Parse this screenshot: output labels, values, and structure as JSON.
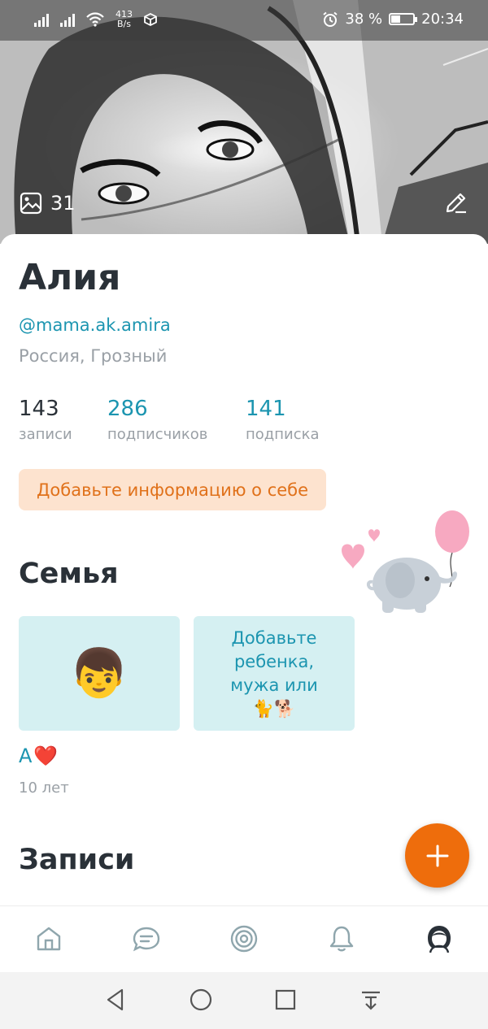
{
  "status_bar": {
    "net_speed_value": "413",
    "net_speed_unit": "B/s",
    "battery_percent": "38 %",
    "battery_level": 0.38,
    "time": "20:34"
  },
  "cover": {
    "photo_count": "31",
    "icons": {
      "photos": "image-icon",
      "edit": "pencil-icon"
    }
  },
  "profile": {
    "name": "Алия",
    "handle": "@mama.ak.amira",
    "location": "Россия, Грозный",
    "stats": [
      {
        "value": "143",
        "label": "записи"
      },
      {
        "value": "286",
        "label": "подписчиков"
      },
      {
        "value": "141",
        "label": "подписка"
      }
    ],
    "about_button": "Добавьте информацию о себе"
  },
  "family": {
    "title": "Семья",
    "child": {
      "emoji": "👦",
      "name": "А",
      "name_emoji": "❤️",
      "age": "10 лет"
    },
    "add_tile_lines": [
      "Добавьте",
      "ребенка,",
      "мужа или",
      "🐈🐕"
    ]
  },
  "posts": {
    "title": "Записи"
  },
  "fab": {
    "icon": "plus-icon"
  },
  "bottom_nav": {
    "items": [
      "home-icon",
      "chat-icon",
      "target-icon",
      "bell-icon",
      "profile-icon"
    ],
    "active_color": "#2a3138",
    "inactive_color": "#8fa6ad"
  },
  "colors": {
    "accent_blue": "#1c95b0",
    "accent_orange": "#ee6d0c",
    "about_bg": "#fde3cf",
    "tile_bg": "#d5f0f2"
  }
}
